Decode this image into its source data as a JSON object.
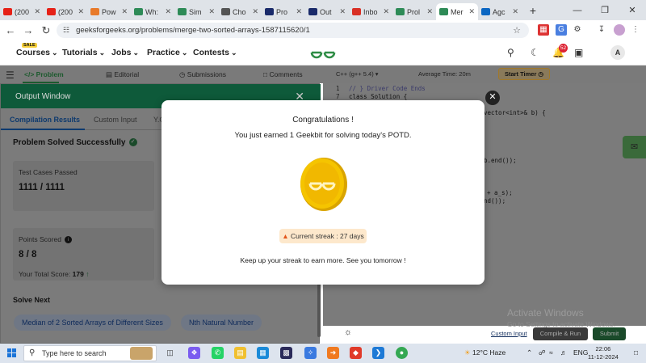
{
  "browser": {
    "tabs": [
      {
        "label": "(200",
        "fav_color": "#e62117",
        "icon": "youtube-icon"
      },
      {
        "label": "(200",
        "fav_color": "#e62117",
        "icon": "youtube-icon"
      },
      {
        "label": "Pow",
        "fav_color": "#e87a2a",
        "icon": "pow-icon"
      },
      {
        "label": "Wh:",
        "fav_color": "#2e8b57",
        "icon": "gfg-icon"
      },
      {
        "label": "Sim",
        "fav_color": "#2e8b57",
        "icon": "gfg-icon"
      },
      {
        "label": "Cho",
        "fav_color": "#555555",
        "icon": "globe-icon"
      },
      {
        "label": "Pro",
        "fav_color": "#1a2a6a",
        "icon": "hackerrank-icon"
      },
      {
        "label": "Out",
        "fav_color": "#1a2a6a",
        "icon": "hackerrank-icon"
      },
      {
        "label": "Inbo",
        "fav_color": "#d93025",
        "icon": "gmail-icon"
      },
      {
        "label": "Prol",
        "fav_color": "#2e8b57",
        "icon": "gfg-icon"
      },
      {
        "label": "Mer",
        "fav_color": "#2e8b57",
        "icon": "gfg-icon",
        "active": true
      },
      {
        "label": "Agc",
        "fav_color": "#0a66c2",
        "icon": "linkedin-icon"
      }
    ],
    "new_tab": "+",
    "url": "geeksforgeeks.org/problems/merge-two-sorted-arrays-1587115620/1"
  },
  "header": {
    "sale": "SALE",
    "nav": [
      "Courses",
      "Tutorials",
      "Jobs",
      "Practice",
      "Contests"
    ],
    "notif_count": "52",
    "avatar": "A"
  },
  "problem_tabs": [
    "Problem",
    "Editorial",
    "Submissions",
    "Comments"
  ],
  "editor": {
    "language": "C++ (g++ 5.4)",
    "avg_time": "Average Time: 20m",
    "timer_label": "Start Timer",
    "line_numbers": [
      "1",
      "7"
    ],
    "code_lines": [
      "// } Driver Code Ends",
      "class Solution {",
      "vector<int>& b) {",
      "b.end());",
      "+ a_s);",
      "nd());"
    ],
    "activate_title": "Activate Windows",
    "activate_sub": "Go to Settings to activate Windows.",
    "custom_input": "Custom Input",
    "compile_run": "Compile & Run",
    "submit": "Submit"
  },
  "output": {
    "title": "Output Window",
    "tabs": [
      "Compilation Results",
      "Custom Input",
      "Y.C"
    ],
    "solved": "Problem Solved Successfully",
    "test_cases_label": "Test Cases Passed",
    "test_cases_value": "1111 / 1111",
    "points_label": "Points Scored",
    "points_value": "8 / 8",
    "total_score_label": "Your Total Score:",
    "total_score_value": "179",
    "solve_next": "Solve Next",
    "suggestions": [
      "Median of 2 Sorted Arrays of Different Sizes",
      "Nth Natural Number"
    ]
  },
  "modal": {
    "title": "Congratulations !",
    "subtitle": "You just earned 1 Geekbit for solving today's POTD.",
    "streak": "Current streak : 27 days",
    "footer": "Keep up your streak to earn more. See you tomorrow !"
  },
  "taskbar": {
    "search_placeholder": "Type here to search",
    "weather": "12°C  Haze",
    "lang": "ENG",
    "time": "22:06",
    "date": "11-12-2024"
  }
}
